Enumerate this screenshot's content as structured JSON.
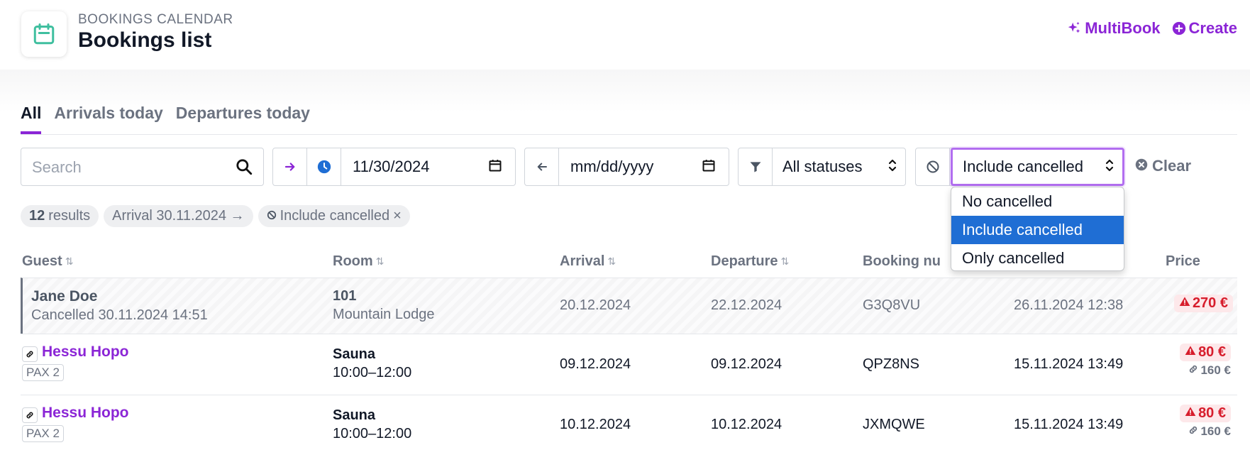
{
  "header": {
    "supertitle": "BOOKINGS CALENDAR",
    "title": "Bookings list",
    "multibook_label": "MultiBook",
    "create_label": "Create",
    "accent": "#8b25d6"
  },
  "tabs": [
    {
      "label": "All",
      "active": true
    },
    {
      "label": "Arrivals today",
      "active": false
    },
    {
      "label": "Departures today",
      "active": false
    }
  ],
  "filters": {
    "search_placeholder": "Search",
    "arrival_date": "11/30/2024",
    "departure_placeholder": "mm/dd/yyyy",
    "status_value": "All statuses",
    "cancel_value": "Include cancelled",
    "clear_label": "Clear"
  },
  "dropdown": {
    "options": [
      "No cancelled",
      "Include cancelled",
      "Only cancelled"
    ],
    "selected": "Include cancelled"
  },
  "chips": {
    "count": "12",
    "results": "results",
    "arrival": "Arrival 30.11.2024 →",
    "cancelled": "Include cancelled",
    "remove": "×"
  },
  "table": {
    "headers": [
      "Guest",
      "Room",
      "Arrival",
      "Departure",
      "Booking nu",
      "",
      "Price"
    ],
    "rows": [
      {
        "guest": "Jane Doe",
        "guest_sub": "Cancelled 30.11.2024 14:51",
        "room": "101",
        "room_sub": "Mountain Lodge",
        "arrival": "20.12.2024",
        "departure": "22.12.2024",
        "booking": "G3Q8VU",
        "created": "26.11.2024 12:38",
        "price": "270 €"
      },
      {
        "guest": "Hessu Hopo",
        "guest_sub": "PAX 2",
        "room": "Sauna",
        "room_sub": "10:00–12:00",
        "arrival": "09.12.2024",
        "departure": "09.12.2024",
        "booking": "QPZ8NS",
        "created": "15.11.2024 13:49",
        "price": "80 €",
        "linked_price": "160 €"
      },
      {
        "guest": "Hessu Hopo",
        "guest_sub": "PAX 2",
        "room": "Sauna",
        "room_sub": "10:00–12:00",
        "arrival": "10.12.2024",
        "departure": "10.12.2024",
        "booking": "JXMQWE",
        "created": "15.11.2024 13:49",
        "price": "80 €",
        "linked_price": "160 €"
      }
    ]
  }
}
